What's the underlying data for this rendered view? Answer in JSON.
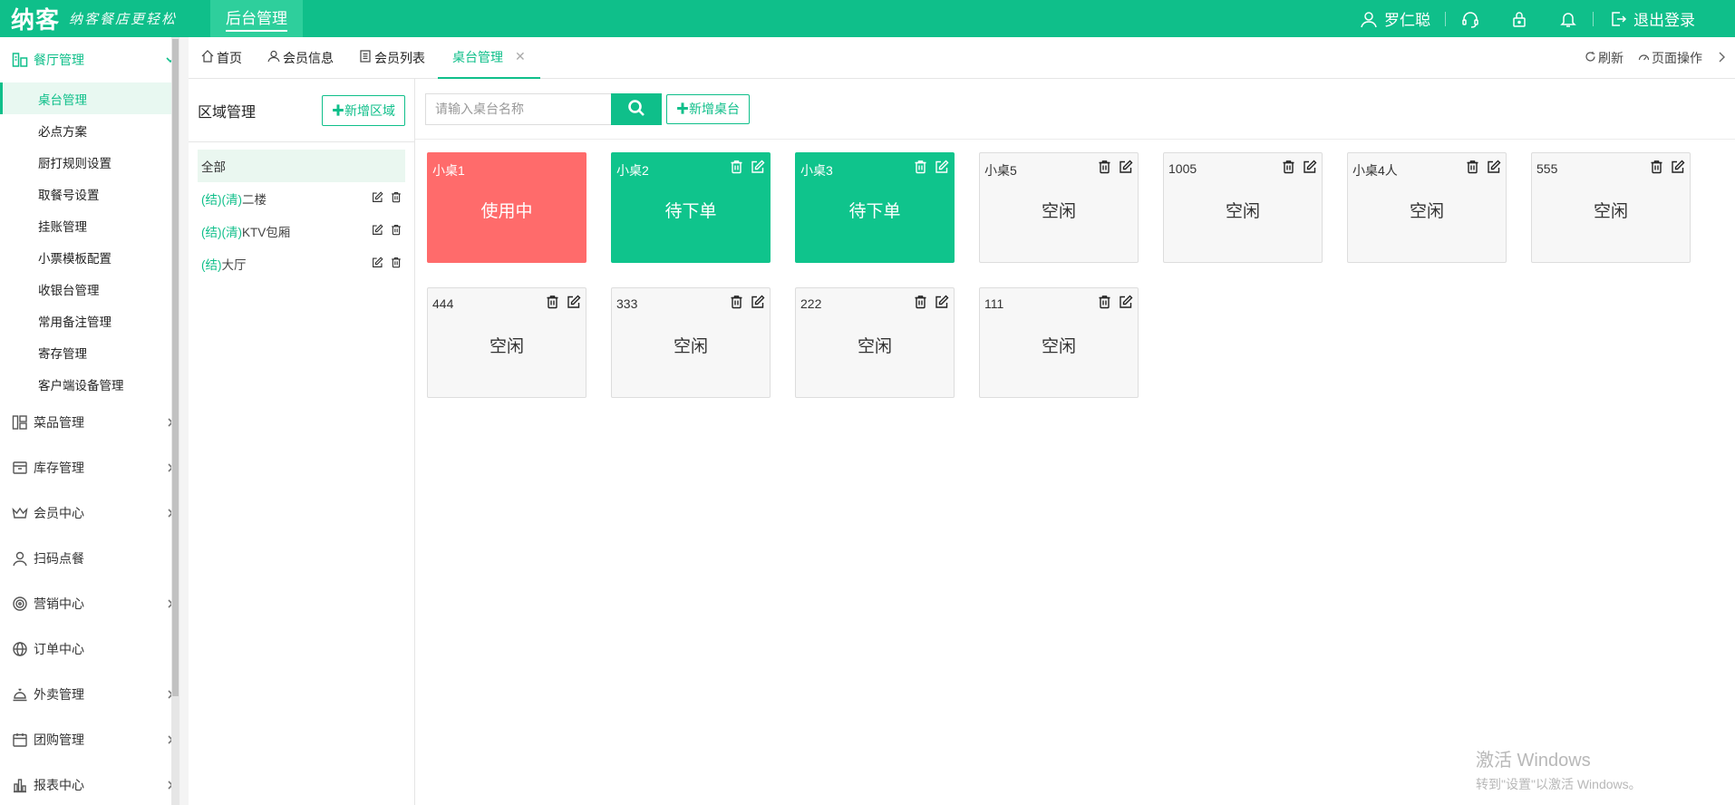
{
  "topbar": {
    "logo": "纳客",
    "slogan": "纳客餐店更轻松",
    "active_tab": "后台管理",
    "user": "罗仁聪",
    "logout": "退出登录"
  },
  "sidebar": {
    "groups": [
      {
        "label": "餐厅管理",
        "icon": "restaurant-icon",
        "expanded": true,
        "items": [
          "桌台管理",
          "必点方案",
          "厨打规则设置",
          "取餐号设置",
          "挂账管理",
          "小票模板配置",
          "收银台管理",
          "常用备注管理",
          "寄存管理",
          "客户端设备管理"
        ],
        "active_item": "桌台管理"
      },
      {
        "label": "菜品管理",
        "icon": "dishes-icon"
      },
      {
        "label": "库存管理",
        "icon": "inventory-icon"
      },
      {
        "label": "会员中心",
        "icon": "crown-icon"
      },
      {
        "label": "扫码点餐",
        "icon": "user-icon"
      },
      {
        "label": "营销中心",
        "icon": "target-icon"
      },
      {
        "label": "订单中心",
        "icon": "globe-icon"
      },
      {
        "label": "外卖管理",
        "icon": "bell-service-icon"
      },
      {
        "label": "团购管理",
        "icon": "calendar-icon"
      },
      {
        "label": "报表中心",
        "icon": "bar-chart-icon"
      }
    ]
  },
  "tabs": {
    "items": [
      {
        "label": "首页",
        "icon": "home-icon"
      },
      {
        "label": "会员信息",
        "icon": "user-icon"
      },
      {
        "label": "会员列表",
        "icon": "list-icon"
      },
      {
        "label": "桌台管理",
        "active": true
      }
    ],
    "refresh": "刷新",
    "page_ops": "页面操作"
  },
  "area": {
    "title": "区域管理",
    "add_button": "✚新增区域",
    "all": "全部",
    "rows": [
      {
        "tag": "(结)(清)",
        "name": "二楼"
      },
      {
        "tag": "(结)(清)",
        "name": "KTV包厢"
      },
      {
        "tag": "(结)",
        "name": "大厅"
      }
    ]
  },
  "main": {
    "search_placeholder": "请输入桌台名称",
    "add_table_button": "✚新增桌台"
  },
  "tables": [
    {
      "name": "小桌1",
      "status": "使用中",
      "state": "inuse",
      "actions": false
    },
    {
      "name": "小桌2",
      "status": "待下单",
      "state": "pending",
      "actions": true
    },
    {
      "name": "小桌3",
      "status": "待下单",
      "state": "pending",
      "actions": true
    },
    {
      "name": "小桌5",
      "status": "空闲",
      "state": "idle",
      "actions": true
    },
    {
      "name": "1005",
      "status": "空闲",
      "state": "idle",
      "actions": true
    },
    {
      "name": "小桌4人",
      "status": "空闲",
      "state": "idle",
      "actions": true
    },
    {
      "name": "555",
      "status": "空闲",
      "state": "idle",
      "actions": true
    },
    {
      "name": "444",
      "status": "空闲",
      "state": "idle",
      "actions": true
    },
    {
      "name": "333",
      "status": "空闲",
      "state": "idle",
      "actions": true
    },
    {
      "name": "222",
      "status": "空闲",
      "state": "idle",
      "actions": true
    },
    {
      "name": "111",
      "status": "空闲",
      "state": "idle",
      "actions": true
    }
  ],
  "watermark": {
    "line1": "激活 Windows",
    "line2": "转到\"设置\"以激活 Windows。"
  },
  "colors": {
    "primary": "#0fbf8a",
    "inuse": "#ff6b6b",
    "pending": "#0fc48c"
  }
}
